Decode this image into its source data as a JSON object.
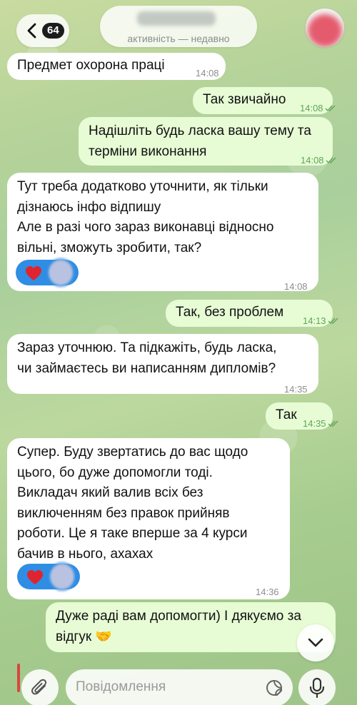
{
  "header": {
    "back_badge": "64",
    "status": "активність — недавно"
  },
  "messages": [
    {
      "dir": "in",
      "text": "Предмет охорона праці",
      "time": "14:08"
    },
    {
      "dir": "out",
      "text": "Так звичайно",
      "time": "14:08",
      "read": true
    },
    {
      "dir": "out",
      "text": "Надішліть будь ласка вашу тему та\nтерміни виконання",
      "time": "14:08",
      "read": true
    },
    {
      "dir": "in",
      "text": "Тут треба додатково уточнити, як тільки\nдізнаюсь інфо відпишу\nАле в разі чого зараз виконавці відносно\nвільні, зможуть зробити, так?",
      "time": "14:08",
      "reaction": "heart"
    },
    {
      "dir": "out",
      "text": "Так, без проблем",
      "time": "14:13",
      "read": true
    },
    {
      "dir": "in",
      "text": "Зараз уточнюю. Та підкажіть, будь ласка,\nчи займаєтесь ви написанням дипломів?",
      "time": "14:35"
    },
    {
      "dir": "out",
      "text": "Так",
      "time": "14:35",
      "read": true
    },
    {
      "dir": "in",
      "text": "Супер. Буду звертатись до вас щодо\nцього, бо дуже допомогли тоді.\nВикладач який валив всіх без\nвиключенням без правок прийняв\nроботи. Це я таке вперше за 4 курси\nбачив в нього, ахахах",
      "time": "14:36",
      "reaction": "heart"
    },
    {
      "dir": "out",
      "text": "Дуже раді вам допомогти) І дякуємо за\nвідгук 🤝",
      "time": ""
    }
  ],
  "composer": {
    "placeholder": "Повідомлення"
  },
  "colors": {
    "incoming": "#ffffff",
    "outgoing": "#e7fcd5",
    "reaction": "#2f8de4",
    "heart": "#e0242f"
  },
  "icons": {
    "back": "chevron-left-icon",
    "attach": "paperclip-icon",
    "sticker": "sticker-icon",
    "mic": "microphone-icon",
    "scroll": "chevron-down-icon",
    "read": "double-check-icon"
  }
}
